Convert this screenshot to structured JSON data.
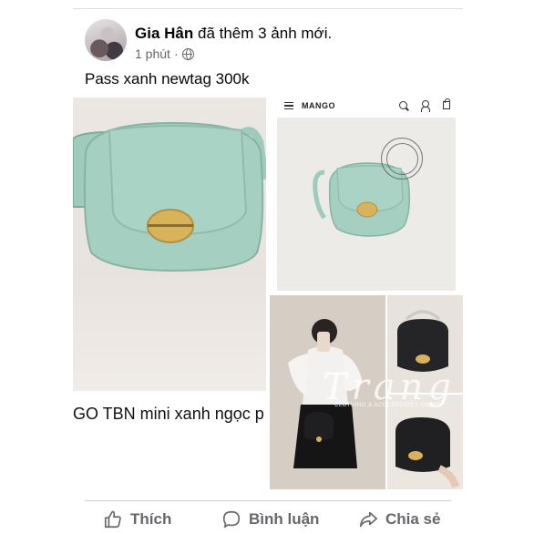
{
  "post": {
    "author": "Gia Hân",
    "action": "đã thêm 3 ảnh mới.",
    "time": "1 phút",
    "separator": "·",
    "privacy_icon": "globe-icon",
    "text": "Pass xanh newtag 300k"
  },
  "photos": {
    "left_caption": "GO TBN mini xanh ngọc p",
    "mango": {
      "brand": "MANGO",
      "brand_small": "Mango",
      "icons": [
        "menu-icon",
        "search-icon",
        "user-icon",
        "bag-icon"
      ]
    },
    "watermark": {
      "script": "Trang",
      "tagline": "CLOTHING & ACCESSORIES ORDER"
    }
  },
  "actions": [
    {
      "label": "Thích",
      "icon": "like-icon"
    },
    {
      "label": "Bình luận",
      "icon": "comment-icon"
    },
    {
      "label": "Chia sẻ",
      "icon": "share-icon"
    }
  ],
  "colors": {
    "text": "#050505",
    "secondary": "#65676b",
    "bag_mint": "#9fcbbd",
    "bag_black": "#1f1f21",
    "clasp_gold": "#d9b35c"
  }
}
